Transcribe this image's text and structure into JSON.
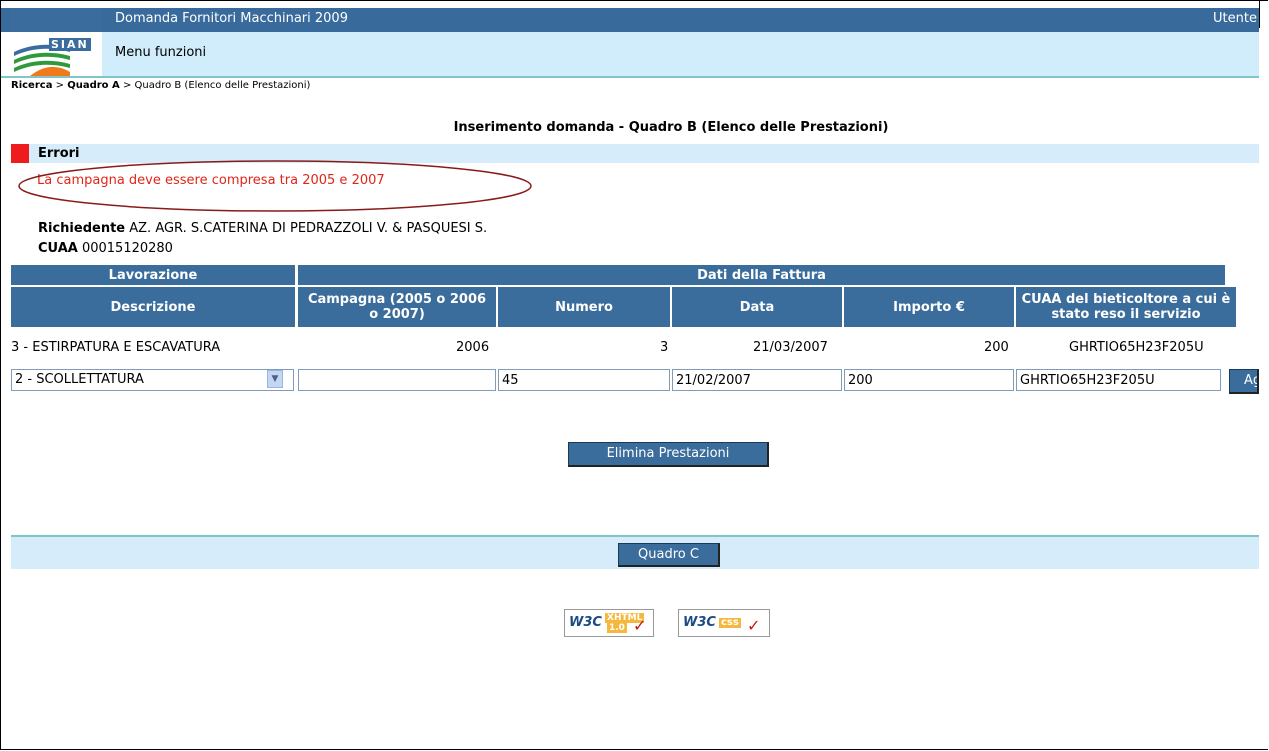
{
  "header": {
    "logo_text": "SIAN",
    "app_title": "Domanda Fornitori Macchinari 2009",
    "user_label": "Utente",
    "menu_label": "Menu funzioni"
  },
  "breadcrumb": {
    "item1": "Ricerca",
    "sep1": " > ",
    "item2": "Quadro A",
    "sep2": " > ",
    "current": "Quadro B (Elenco delle Prestazioni)"
  },
  "page_title": "Inserimento domanda - Quadro B (Elenco delle Prestazioni)",
  "errors": {
    "title": "Errori",
    "message": "La campagna deve essere compresa tra 2005 e 2007"
  },
  "applicant": {
    "label": "Richiedente",
    "name": "AZ. AGR. S.CATERINA DI PEDRAZZOLI V. & PASQUESI S.",
    "cuaa_label": "CUAA",
    "cuaa_value": "00015120280"
  },
  "table": {
    "group_headers": [
      "Lavorazione",
      "Dati della Fattura"
    ],
    "columns": [
      "Descrizione",
      "Campagna (2005 o 2006 o 2007)",
      "Numero",
      "Data",
      "Importo €",
      "CUAA del bieticoltore a cui è stato reso il servizio"
    ],
    "rows": [
      {
        "descrizione": "3 - ESTIRPATURA E ESCAVATURA",
        "campagna": "2006",
        "numero": "3",
        "data": "21/03/2007",
        "importo": "200",
        "cuaa": "GHRTIO65H23F205U"
      }
    ],
    "input_row": {
      "descrizione": "2 - SCOLLETTATURA",
      "campagna": "",
      "numero": "45",
      "data": "21/02/2007",
      "importo": "200",
      "cuaa": "GHRTIO65H23F205U",
      "add_button": "Ag"
    }
  },
  "buttons": {
    "delete": "Elimina Prestazioni",
    "next": "Quadro C"
  },
  "badges": {
    "xhtml_w3c": "W3C",
    "xhtml_tag1": "XHTML",
    "xhtml_tag2": "1.0",
    "css_w3c": "W3C",
    "css_tag": "css"
  },
  "colors": {
    "header_blue": "#396a9c",
    "light_blue": "#d6ecfa",
    "error_red": "#e0261a"
  }
}
